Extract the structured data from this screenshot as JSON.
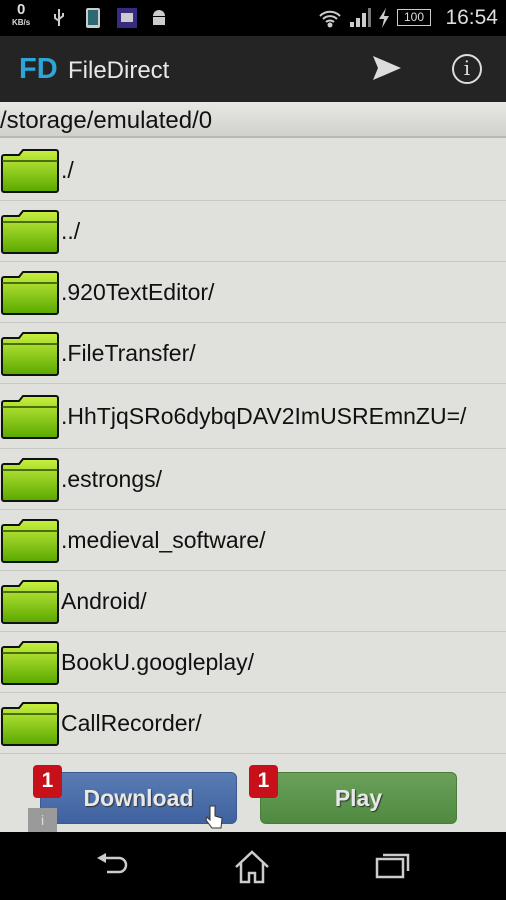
{
  "status_bar": {
    "data_rate": "0",
    "data_unit": "KB/s",
    "battery": "100",
    "time": "16:54",
    "icons": [
      "usb-icon",
      "phone-icon",
      "news-icon",
      "android-icon",
      "wifi-icon",
      "signal-icon",
      "charging-icon",
      "battery-icon"
    ]
  },
  "action_bar": {
    "logo": "FD",
    "title": "FileDirect",
    "actions": [
      "send-icon",
      "info-icon"
    ]
  },
  "path": "/storage/emulated/0",
  "files": [
    {
      "name": "./"
    },
    {
      "name": "../"
    },
    {
      "name": ".920TextEditor/"
    },
    {
      "name": ".FileTransfer/"
    },
    {
      "name": ".HhTjqSRo6dybqDAV2ImUSREmnZU=/"
    },
    {
      "name": ".estrongs/"
    },
    {
      "name": ".medieval_software/"
    },
    {
      "name": "Android/"
    },
    {
      "name": "BookU.googleplay/"
    },
    {
      "name": "CallRecorder/"
    }
  ],
  "ad": {
    "download_label": "Download",
    "download_badge": "1",
    "play_label": "Play",
    "play_badge": "1",
    "info_icon": "i"
  },
  "nav": [
    "back-icon",
    "home-icon",
    "recents-icon"
  ],
  "colors": {
    "accent": "#2ea5d8",
    "download": "#4a6ca8",
    "play": "#5d964c",
    "badge": "#c8101a"
  }
}
